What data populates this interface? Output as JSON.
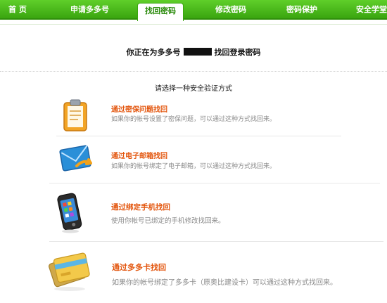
{
  "nav": {
    "items": [
      {
        "label": "首 页",
        "active": false
      },
      {
        "label": "申请多多号",
        "active": false
      },
      {
        "label": "找回密码",
        "active": true
      },
      {
        "label": "修改密码",
        "active": false
      },
      {
        "label": "密码保护",
        "active": false
      },
      {
        "label": "安全学堂",
        "active": false
      }
    ]
  },
  "header": {
    "prefix": "你正在为多多号",
    "suffix": "找回登录密码",
    "instruction": "请选择一种安全验证方式"
  },
  "options": [
    {
      "title": "通过密保问题找回",
      "desc": "如果你的帐号设置了密保问题，可以通过这种方式找回来。",
      "icon": "clipboard-icon"
    },
    {
      "title": "通过电子邮箱找回",
      "desc": "如果你的帐号绑定了电子邮箱，可以通过这种方式找回来。",
      "icon": "email-icon"
    },
    {
      "title": "通过绑定手机找回",
      "desc": "使用你帐号已绑定的手机修改找回来。",
      "icon": "mobile-phone-icon"
    },
    {
      "title": "通过多多卡找回",
      "desc": "如果你的帐号绑定了多多卡（原奥比建设卡）可以通过这种方式找回来。",
      "icon": "card-icon"
    }
  ],
  "colors": {
    "nav_green": "#3aa50f",
    "option_title": "#e3560e",
    "desc_gray": "#8a8a8a"
  }
}
